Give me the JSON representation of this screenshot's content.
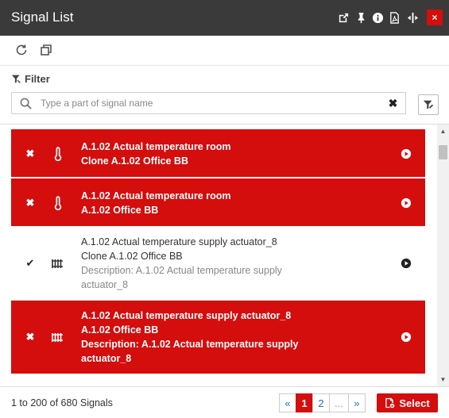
{
  "window": {
    "title": "Signal List",
    "close_label": "×",
    "title_icons": [
      "external-link-icon",
      "pin-icon",
      "info-icon",
      "pdf-file-icon",
      "resize-width-icon"
    ]
  },
  "toolbar": {
    "icons": [
      "refresh-icon",
      "clone-icon"
    ]
  },
  "filter": {
    "label": "Filter",
    "placeholder": "Type a part of signal name",
    "value": "",
    "clear_label": "✖"
  },
  "rows": [
    {
      "selected": true,
      "state_icon": "cross-icon",
      "type_icon": "thermometer-icon",
      "line1": "A.1.02 Actual temperature room",
      "line2": "Clone A.1.02 Office BB",
      "desc1": "",
      "desc2": ""
    },
    {
      "selected": true,
      "state_icon": "cross-icon",
      "type_icon": "thermometer-icon",
      "line1": "A.1.02 Actual temperature room",
      "line2": "A.1.02 Office BB",
      "desc1": "",
      "desc2": ""
    },
    {
      "selected": false,
      "state_icon": "check-icon",
      "type_icon": "radiator-icon",
      "line1": "A.1.02 Actual temperature supply actuator_8",
      "line2": "Clone A.1.02 Office BB",
      "desc1": "Description: A.1.02 Actual temperature supply",
      "desc2": "actuator_8"
    },
    {
      "selected": true,
      "state_icon": "cross-icon",
      "type_icon": "radiator-icon",
      "line1": "A.1.02 Actual temperature supply actuator_8",
      "line2": "A.1.02 Office BB",
      "desc1": "Description: A.1.02 Actual temperature supply",
      "desc2": "actuator_8"
    }
  ],
  "footer": {
    "count": "1 to 200 of 680 Signals",
    "pager": {
      "prev": "«",
      "pages": [
        "1",
        "2"
      ],
      "active_page": "1",
      "ellipsis": "...",
      "next": "»"
    },
    "select_label": "Select"
  },
  "colors": {
    "titlebar": "#3a3a3a",
    "accent_red": "#d40d0d",
    "link_blue": "#2a6fb0"
  }
}
